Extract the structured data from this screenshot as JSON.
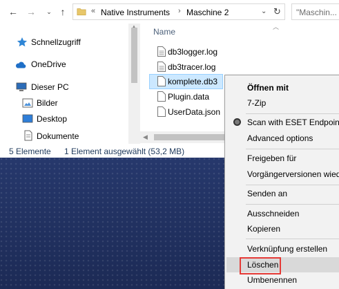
{
  "address": {
    "prefix": "«",
    "segments": [
      "Native Instruments",
      "Maschine 2"
    ],
    "separator": "›"
  },
  "search": {
    "placeholder": "\"Maschin..."
  },
  "nav": {
    "items": [
      {
        "label": "Schnellzugriff",
        "icon": "star-icon"
      },
      {
        "label": "OneDrive",
        "icon": "cloud-icon"
      },
      {
        "label": "Dieser PC",
        "icon": "computer-icon"
      },
      {
        "label": "Bilder",
        "icon": "pictures-icon"
      },
      {
        "label": "Desktop",
        "icon": "desktop-icon"
      },
      {
        "label": "Dokumente",
        "icon": "documents-icon"
      }
    ]
  },
  "filelist": {
    "column_name": "Name",
    "files": [
      {
        "name": "db3logger.log",
        "selected": false
      },
      {
        "name": "db3tracer.log",
        "selected": false
      },
      {
        "name": "komplete.db3",
        "selected": true
      },
      {
        "name": "Plugin.data",
        "selected": false
      },
      {
        "name": "UserData.json",
        "selected": false
      }
    ]
  },
  "status": {
    "count": "5 Elemente",
    "selection": "1 Element ausgewählt (53,2 MB)"
  },
  "context_menu": {
    "items": [
      {
        "label": "Öffnen mit",
        "bold": true
      },
      {
        "label": "7-Zip"
      },
      {
        "label": "Scan with ESET Endpoint",
        "radio": true
      },
      {
        "label": "Advanced options"
      },
      {
        "label": "Freigeben für"
      },
      {
        "label": "Vorgängerversionen wied"
      },
      {
        "label": "Senden an"
      },
      {
        "label": "Ausschneiden"
      },
      {
        "label": "Kopieren"
      },
      {
        "label": "Verknüpfung erstellen"
      },
      {
        "label": "Löschen",
        "hover": true,
        "highlighted": true
      },
      {
        "label": "Umbenennen"
      }
    ]
  },
  "colors": {
    "selection_bg": "#cce8ff",
    "highlight_border": "#e53935",
    "desktop_bg": "#1f2e5c"
  }
}
